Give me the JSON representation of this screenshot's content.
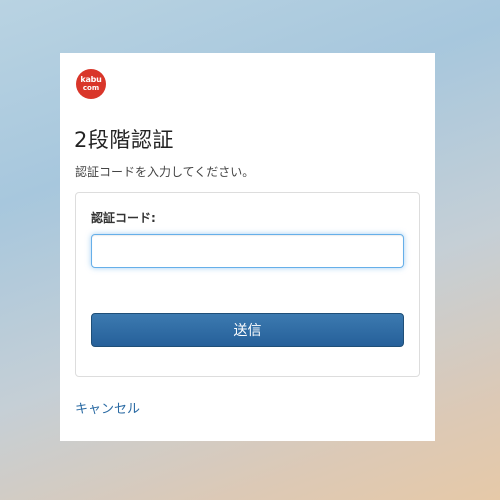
{
  "logo": {
    "line1": "kabu",
    "line2": "com",
    "color": "#d9362a"
  },
  "title": "2段階認証",
  "subtitle": "認証コードを入力してください。",
  "form": {
    "code_label": "認証コード:",
    "code_value": "",
    "submit_label": "送信"
  },
  "cancel_label": "キャンセル",
  "colors": {
    "button": "#26609a",
    "link": "#2a6aa3",
    "focus_border": "#66afe9"
  }
}
